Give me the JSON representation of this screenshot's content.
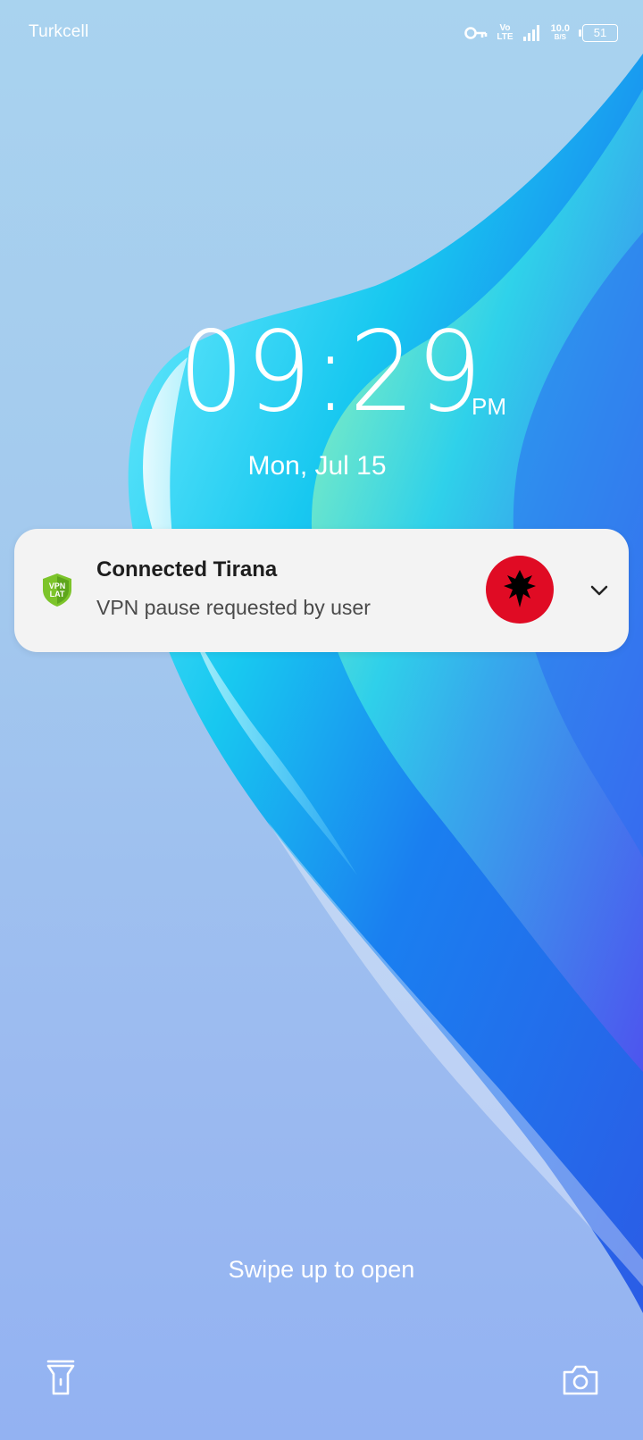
{
  "status_bar": {
    "carrier": "Turkcell",
    "volte_top": "Vo",
    "volte_bottom": "LTE",
    "speed_value": "10.0",
    "speed_unit": "B/S",
    "battery": "51",
    "icons": [
      "vpn-key-icon",
      "volte-icon",
      "signal-icon",
      "network-speed",
      "battery-icon"
    ]
  },
  "clock": {
    "time": "09:29",
    "ampm": "PM"
  },
  "date": "Mon, Jul 15",
  "notification": {
    "app_icon": "vpn-lat-shield-icon",
    "app_icon_text_top": "VPN",
    "app_icon_text_bottom": "LAT",
    "title": "Connected Tirana",
    "text": "VPN pause requested by user",
    "flag": "albania-flag",
    "expand_icon": "chevron-down-icon"
  },
  "swipe_hint": "Swipe up to open",
  "shortcuts": {
    "left": "flashlight-icon",
    "right": "camera-icon"
  },
  "colors": {
    "notification_bg": "#f3f3f3",
    "flag_red": "#e00b24",
    "app_icon_green": "#7cc42a"
  }
}
